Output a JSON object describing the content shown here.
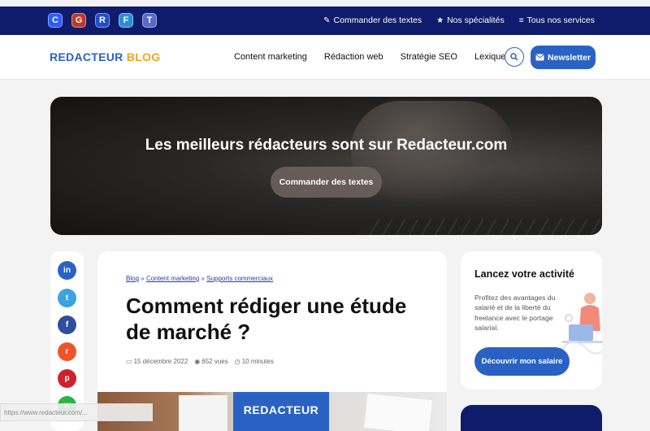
{
  "topbar": {
    "social": [
      {
        "name": "c-icon",
        "letter": "C",
        "color": "#2b5cff"
      },
      {
        "name": "g-icon",
        "letter": "G",
        "color": "#c0392b"
      },
      {
        "name": "r-icon",
        "letter": "R",
        "color": "#1f4fc4"
      },
      {
        "name": "f-icon",
        "letter": "F",
        "color": "#2a8fd6"
      },
      {
        "name": "t-icon",
        "letter": "T",
        "color": "#5b6bc4"
      }
    ],
    "links": [
      {
        "icon": "pencil-icon",
        "glyph": "✎",
        "label": "Commander des textes"
      },
      {
        "icon": "star-icon",
        "glyph": "★",
        "label": "Nos spécialités"
      },
      {
        "icon": "menu-icon",
        "glyph": "≡",
        "label": "Tous nos services"
      }
    ]
  },
  "header": {
    "logo_part1": "REDACTEUR",
    "logo_part2": "BLOG",
    "nav": [
      "Content marketing",
      "Rédaction web",
      "Stratégie SEO",
      "Lexique"
    ],
    "search_icon": "search-icon",
    "newsletter_label": "Newsletter"
  },
  "hero": {
    "title": "Les meilleurs rédacteurs sont sur Redacteur.com",
    "button": "Commander des textes"
  },
  "share": [
    {
      "name": "linkedin-icon",
      "glyph": "in",
      "color": "#2a62c4"
    },
    {
      "name": "twitter-icon",
      "glyph": "t",
      "color": "#3aa3e0"
    },
    {
      "name": "facebook-icon",
      "glyph": "f",
      "color": "#2f4f9e"
    },
    {
      "name": "reddit-icon",
      "glyph": "r",
      "color": "#f0522a"
    },
    {
      "name": "pinterest-icon",
      "glyph": "p",
      "color": "#d0202e"
    },
    {
      "name": "whatsapp-icon",
      "glyph": "w",
      "color": "#2bb344"
    }
  ],
  "article": {
    "breadcrumb": [
      "Blog",
      "Content marketing",
      "Supports commerciaux"
    ],
    "breadcrumb_sep": "»",
    "title": "Comment rédiger une étude de marché ?",
    "date": "15 décembre 2022",
    "views": "652 vues",
    "reading": "10 minutes",
    "image_brand": "REDACTEUR"
  },
  "promo": {
    "title": "Lancez votre activité",
    "text": "Profitez des avantages du salarié et de la liberté du freelance avec le portage salarial.",
    "button": "Découvrir mon salaire"
  },
  "statusbar": {
    "url": "https://www.redacteur.com/..."
  }
}
